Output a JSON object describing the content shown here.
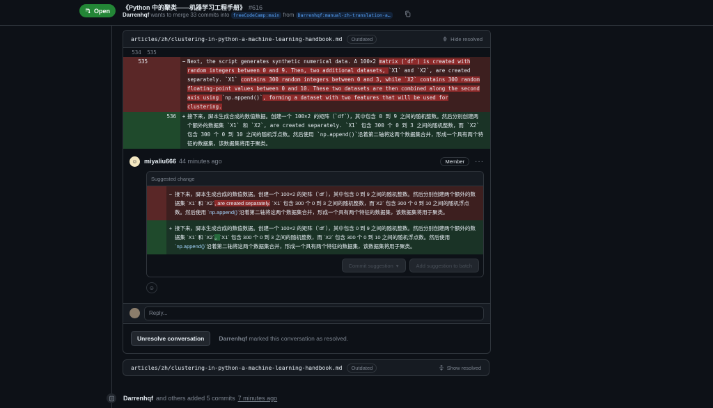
{
  "pr": {
    "state": "Open",
    "title": "《Python 中的聚类——机器学习工程手册》",
    "number": "#616",
    "author": "Darrenhqf",
    "merge_text": "wants to merge 33 commits into",
    "base_branch": "freeCodeCamp:main",
    "from_text": "from",
    "head_branch": "Darrenhqf:manual-zh-translation-a…"
  },
  "thread": {
    "file_path": "articles/zh/clustering-in-python-a-machine-learning-handbook.md",
    "outdated_label": "Outdated",
    "hide_label": "Hide resolved",
    "line_old": "534",
    "line_new": "535",
    "del_line": "535",
    "add_line": "536",
    "del_text_parts": [
      "Next, the script generates synthetic numerical data. A 100×2 ",
      "matrix (`df`) is created with random integers between 0 and 9. Then, two additional datasets, ",
      "`X1` and `X2`, are created separately. `X1` ",
      "contains 300 random integers between 0 and 3, while `X2` contains 300 random floating-point values between 0 and 10. These two datasets are then combined along the second axis using ",
      "`np.append()`",
      ", forming a dataset with two features that will be used for clustering."
    ],
    "add_text_parts": [
      "接下来，脚本生成合成的数值数据。创建一个 100×2 的矩阵（`df`），其中包含 0 到 9 之间的随机整数。然后分别创建两个额外的数据集 `X1` 和 `X2`, are created separately. `X1` 包含 300 个 0 到 3 之间的随机整数，而 `X2` 包含 300 个 0 到 10 之间的随机浮点数。然后使用 `np.append()`沿着第二轴将这两个数据集合并，形成一个具有两个特征的数据集，该数据集将用于聚类。"
    ]
  },
  "comment": {
    "author": "miyaliu666",
    "time": "44 minutes ago",
    "role": "Member",
    "suggestion_header": "Suggested change",
    "sugg_del_parts": [
      "接下来，脚本生成合成的数值数据。创建一个 100×2 的矩阵（`df`），其中包含 0 到 9 之间的随机整数。然后分别创建两个额外的数据集 `X1` 和 `X2`",
      ", are created separately.",
      " `X1` 包含 300 个 0 到 3 之间的随机整数，而`X2` 包含 300 个 0 到 10 之间的随机浮点数。然后使用 ",
      "`np.append()`",
      "沿着第二轴将这两个数据集合并，形成一个具有两个特征的数据集，该数据集将用于聚类。"
    ],
    "sugg_add_parts": [
      "接下来，脚本生成合成的数值数据。创建一个 100×2 的矩阵（`df`），其中包含 0 到 9 之间的随机整数。然后分别创建两个额外的数据集 `X1` 和 `X2`",
      "。",
      "`X1` 包含 300 个 0 到 3 之间的随机整数，而 `X2` 包含 300 个 0 到 10 之间的随机浮点数。然后使用 ",
      "`np.append()`",
      "沿着第二轴将这两个数据集合并，形成一个具有两个特征的数据集，该数据集将用于聚类。"
    ],
    "commit_label": "Commit suggestion",
    "batch_label": "Add suggestion to batch"
  },
  "reply": {
    "placeholder": "Reply..."
  },
  "resolve": {
    "button": "Unresolve conversation",
    "actor": "Darrenhqf",
    "text": "marked this conversation as resolved."
  },
  "thread2": {
    "file_path": "articles/zh/clustering-in-python-a-machine-learning-handbook.md",
    "outdated_label": "Outdated",
    "show_label": "Show resolved"
  },
  "event": {
    "actor": "Darrenhqf",
    "text": "and others added 5 commits",
    "time": "7 minutes ago"
  },
  "colors": {
    "open_green": "#238636",
    "deletion_bg": "#3d1f1f",
    "addition_bg": "#1a3326",
    "link_blue": "#58a6ff"
  }
}
